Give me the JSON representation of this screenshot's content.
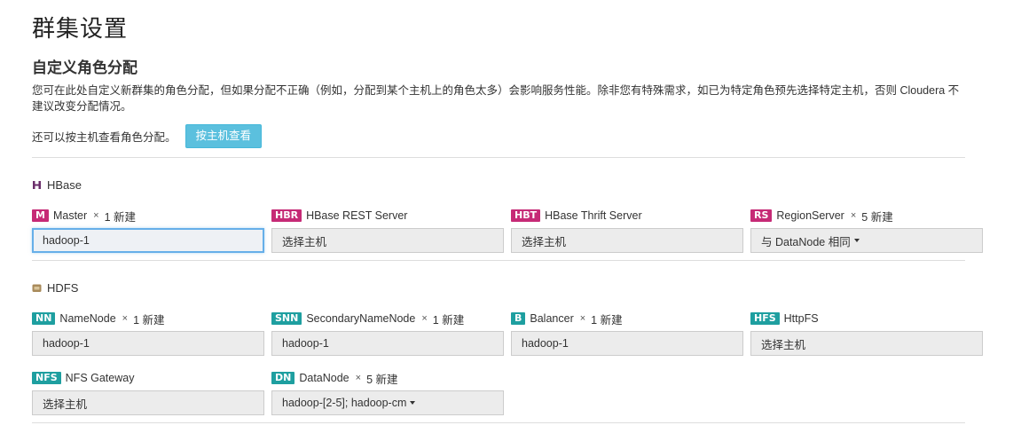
{
  "page": {
    "title": "群集设置",
    "section_title": "自定义角色分配",
    "description": "您可在此处自定义新群集的角色分配，但如果分配不正确（例如，分配到某个主机上的角色太多）会影响服务性能。除非您有特殊需求，如已为特定角色预先选择特定主机，否则 Cloudera 不建议改变分配情况。",
    "host_view_text": "还可以按主机查看角色分配。",
    "host_view_button": "按主机查看"
  },
  "colors": {
    "hbase_badge": "#c62a76",
    "hdfs_badge": "#1e9fa0",
    "button": "#5bc0de"
  },
  "hbase": {
    "name": "HBase",
    "icon": "hbase-icon",
    "roles": [
      {
        "abbr": "M",
        "name": "Master",
        "count": "1 新建",
        "host": "hadoop-1"
      },
      {
        "abbr": "HBR",
        "name": "HBase REST Server",
        "host": "选择主机"
      },
      {
        "abbr": "HBT",
        "name": "HBase Thrift Server",
        "host": "选择主机"
      },
      {
        "abbr": "RS",
        "name": "RegionServer",
        "count": "5 新建",
        "host": "与 DataNode 相同"
      }
    ]
  },
  "hdfs": {
    "name": "HDFS",
    "icon": "hdfs-icon",
    "roles": [
      {
        "abbr": "NN",
        "name": "NameNode",
        "count": "1 新建",
        "host": "hadoop-1"
      },
      {
        "abbr": "SNN",
        "name": "SecondaryNameNode",
        "count": "1 新建",
        "host": "hadoop-1"
      },
      {
        "abbr": "B",
        "name": "Balancer",
        "count": "1 新建",
        "host": "hadoop-1"
      },
      {
        "abbr": "HFS",
        "name": "HttpFS",
        "host": "选择主机"
      },
      {
        "abbr": "NFS",
        "name": "NFS Gateway",
        "host": "选择主机"
      },
      {
        "abbr": "DN",
        "name": "DataNode",
        "count": "5 新建",
        "host": "hadoop-[2-5]; hadoop-cm"
      }
    ]
  },
  "multiplier": "×"
}
